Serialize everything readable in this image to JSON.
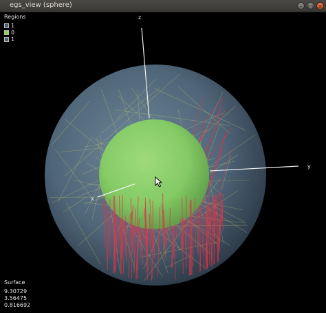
{
  "window": {
    "title": "egs_view (sphere)"
  },
  "legend": {
    "title": "Regions",
    "items": [
      {
        "label": "1",
        "color": "#4a6073"
      },
      {
        "label": "0",
        "color": "#8bd24a"
      },
      {
        "label": "1",
        "color": "#4a6073"
      }
    ]
  },
  "axes": {
    "x": "x",
    "y": "y",
    "z": "z"
  },
  "surface": {
    "label": "Surface",
    "values": [
      "9.30729",
      "3.56475",
      "0.816692"
    ]
  },
  "colors": {
    "outer_sphere": "#4f6578",
    "inner_sphere": "#86d163",
    "tracks_red": "#e0344a",
    "tracks_yellow": "#cdd46a",
    "background": "#000000"
  }
}
